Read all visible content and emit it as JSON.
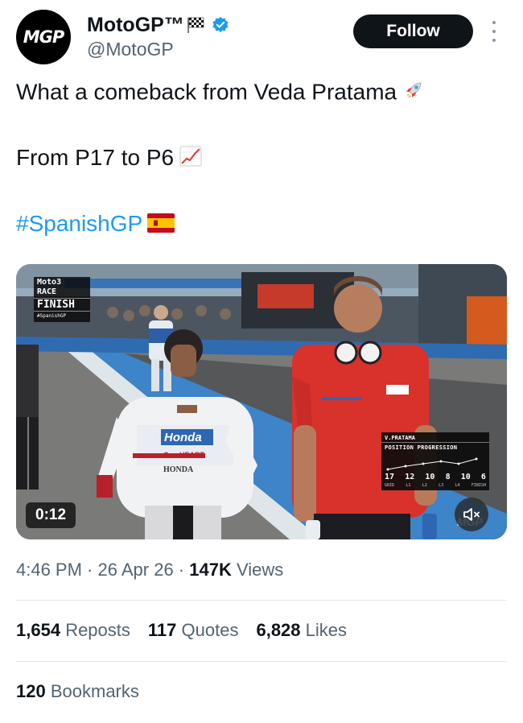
{
  "author": {
    "display_name": "MotoGP™",
    "handle": "@MotoGP",
    "avatar_text": "MGP",
    "follow_label": "Follow"
  },
  "tweet": {
    "line1": "What a comeback from Veda Pratama",
    "line2": "From P17 to P6",
    "hashtag": "#SpanishGP"
  },
  "media": {
    "duration": "0:12",
    "finish_overlay": {
      "brand": "Moto3",
      "race": "RACE",
      "status": "FINISH",
      "tag": "#SpanishGP"
    },
    "progress_overlay": {
      "rider": "V.PRATAMA",
      "title": "POSITION PROGRESSION",
      "positions": [
        "17",
        "12",
        "10",
        "8",
        "10",
        "6"
      ],
      "labels": [
        "GRID",
        "L1",
        "L2",
        "L3",
        "L4",
        "FINISH"
      ]
    },
    "suit_text": "One HEART"
  },
  "meta": {
    "time": "4:46 PM",
    "date": "26 Apr 26",
    "views_count": "147K",
    "views_label": "Views"
  },
  "stats": {
    "reposts_count": "1,654",
    "reposts_label": "Reposts",
    "quotes_count": "117",
    "quotes_label": "Quotes",
    "likes_count": "6,828",
    "likes_label": "Likes",
    "bookmarks_count": "120",
    "bookmarks_label": "Bookmarks"
  },
  "colors": {
    "follow_bg": "#0f1419",
    "link": "#1d9bf0",
    "verified": "#1d9bf0",
    "secondary_text": "#536471"
  },
  "icons": [
    "checkered-flag-icon",
    "verified-badge-icon",
    "more-options-icon",
    "rocket-icon",
    "chart-increasing-icon",
    "spain-flag-icon",
    "mute-icon"
  ]
}
